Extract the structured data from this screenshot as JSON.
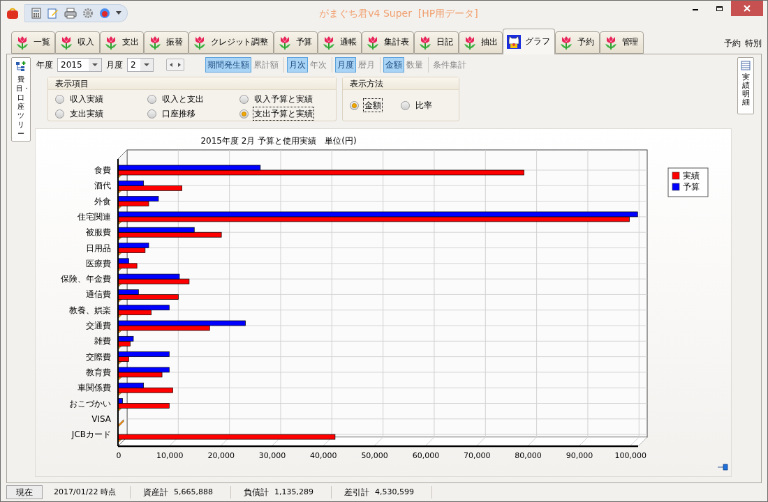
{
  "window": {
    "title": "がまぐち君v4 Super  [HP用データ]"
  },
  "tabs": [
    {
      "label": "一覧",
      "selected": false,
      "kind": "tulip"
    },
    {
      "label": "収入",
      "selected": false,
      "kind": "tulip"
    },
    {
      "label": "支出",
      "selected": false,
      "kind": "tulip"
    },
    {
      "label": "振替",
      "selected": false,
      "kind": "tulip"
    },
    {
      "label": "クレジット調整",
      "selected": false,
      "kind": "tulip"
    },
    {
      "label": "予算",
      "selected": false,
      "kind": "tulip"
    },
    {
      "label": "通帳",
      "selected": false,
      "kind": "tulip"
    },
    {
      "label": "集計表",
      "selected": false,
      "kind": "tulip"
    },
    {
      "label": "日記",
      "selected": false,
      "kind": "tulip"
    },
    {
      "label": "抽出",
      "selected": false,
      "kind": "tulip"
    },
    {
      "label": "グラフ",
      "selected": true,
      "kind": "cat"
    },
    {
      "label": "予約",
      "selected": false,
      "kind": "tulip"
    },
    {
      "label": "管理",
      "selected": false,
      "kind": "tulip"
    }
  ],
  "top_right_links": [
    "予約",
    "特別"
  ],
  "side_tabs": {
    "left": "費目・口座ツリー",
    "right": "実績明細"
  },
  "filter_bar": {
    "year_label": "年度",
    "year": "2015",
    "month_label": "月度",
    "month": "2",
    "toggle_groups": [
      [
        {
          "label": "期間発生額",
          "selected": true
        },
        {
          "label": "累計額",
          "selected": false
        }
      ],
      [
        {
          "label": "月次",
          "selected": true
        },
        {
          "label": "年次",
          "selected": false
        }
      ],
      [
        {
          "label": "月度",
          "selected": true
        },
        {
          "label": "暦月",
          "selected": false
        }
      ],
      [
        {
          "label": "金額",
          "selected": true
        },
        {
          "label": "数量",
          "selected": false
        }
      ]
    ],
    "extra_button": "条件集計"
  },
  "display_items": {
    "title": "表示項目",
    "options": [
      {
        "label": "収入実績",
        "selected": false
      },
      {
        "label": "収入と支出",
        "selected": false
      },
      {
        "label": "収入予算と実績",
        "selected": false
      },
      {
        "label": "支出実績",
        "selected": false
      },
      {
        "label": "口座推移",
        "selected": false
      },
      {
        "label": "支出予算と実績",
        "selected": true
      }
    ]
  },
  "display_method": {
    "title": "表示方法",
    "options": [
      {
        "label": "金額",
        "selected": true
      },
      {
        "label": "比率",
        "selected": false
      }
    ]
  },
  "chart": {
    "chart_data": {
      "type": "bar",
      "orientation": "horizontal",
      "title": "2015年度 2月 予算と使用実績　単位(円)",
      "categories": [
        "食費",
        "酒代",
        "外食",
        "住宅関連",
        "被服費",
        "日用品",
        "医療費",
        "保険、年金費",
        "通信費",
        "教養、娯楽",
        "交通費",
        "雑費",
        "交際費",
        "教育費",
        "車関係費",
        "おこづかい",
        "VISA",
        "JCBカード"
      ],
      "series": [
        {
          "name": "予算",
          "color": "#0000ff",
          "values": [
            27800,
            5000,
            7900,
            101500,
            14900,
            6000,
            2100,
            12000,
            4000,
            10000,
            24900,
            3000,
            10000,
            10000,
            5000,
            900,
            0,
            0
          ]
        },
        {
          "name": "実績",
          "color": "#ff0000",
          "values": [
            79300,
            12500,
            6000,
            99900,
            20200,
            5300,
            3700,
            13900,
            11800,
            6500,
            17900,
            2400,
            2100,
            8600,
            10700,
            10000,
            0,
            42400
          ]
        }
      ],
      "xlim": [
        0,
        101600
      ],
      "grid": true,
      "legend": "right",
      "xticks": [
        {
          "value": 0,
          "label": "0"
        },
        {
          "value": 10000,
          "label": "10,000"
        },
        {
          "value": 20000,
          "label": "20,000"
        },
        {
          "value": 30000,
          "label": "30,000"
        },
        {
          "value": 40000,
          "label": "40,000"
        },
        {
          "value": 50000,
          "label": "50,000"
        },
        {
          "value": 60000,
          "label": "60,000"
        },
        {
          "value": 70000,
          "label": "70,000"
        },
        {
          "value": 80000,
          "label": "80,000"
        },
        {
          "value": 90000,
          "label": "90,000"
        },
        {
          "value": 100000,
          "label": "100,000"
        }
      ]
    }
  },
  "status_bar": {
    "button": "現在",
    "date": "2017/01/22 時点",
    "fields": [
      {
        "label": "資産計",
        "value": "5,665,888"
      },
      {
        "label": "負債計",
        "value": "1,135,289"
      },
      {
        "label": "差引計",
        "value": "4,530,599"
      }
    ]
  }
}
